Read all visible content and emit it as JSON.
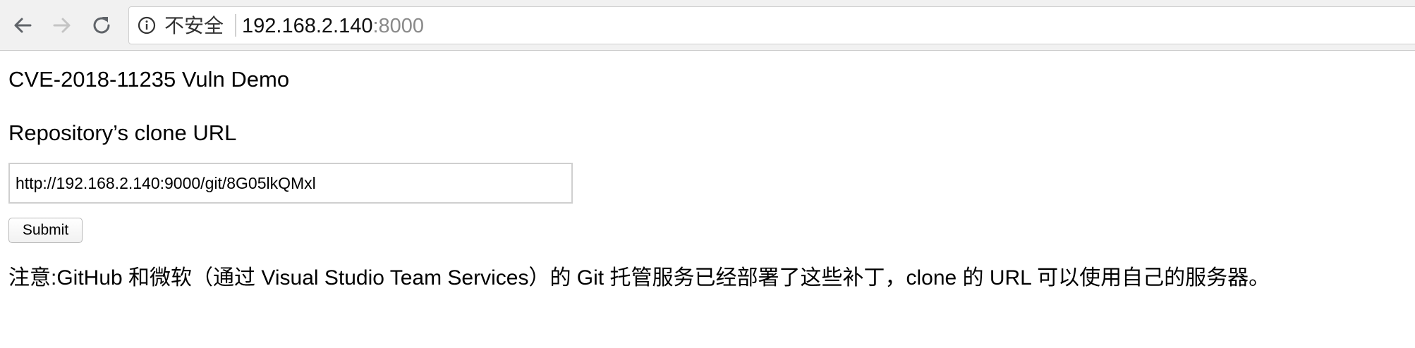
{
  "browser": {
    "security_label": "不安全",
    "url_host": "192.168.2.140",
    "url_port": ":8000",
    "icons": {
      "back": "arrow-left-icon",
      "forward": "arrow-right-icon",
      "reload": "reload-icon",
      "info": "info-icon"
    }
  },
  "page": {
    "title": "CVE-2018-11235 Vuln Demo",
    "field_label": "Repository’s clone URL",
    "input_value": "http://192.168.2.140:9000/git/8G05lkQMxl",
    "submit_label": "Submit",
    "notice": "注意:GitHub 和微软（通过 Visual Studio Team Services）的 Git 托管服务已经部署了这些补丁，clone 的 URL 可以使用自己的服务器。"
  }
}
